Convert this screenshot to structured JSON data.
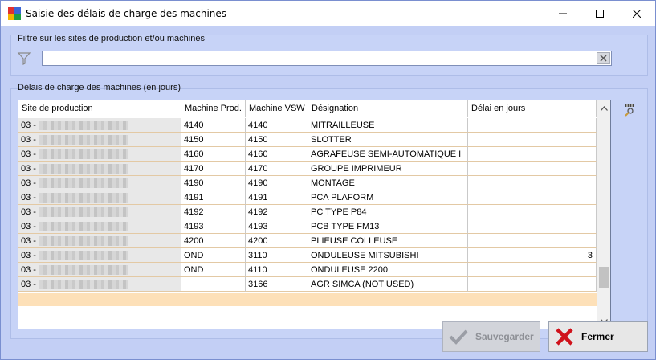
{
  "window": {
    "title": "Saisie des délais de charge des machines",
    "minimize_glyph": "—",
    "maximize_glyph": "☐",
    "close_glyph": "✕"
  },
  "filter": {
    "label": "Filtre sur les sites de production et/ou machines",
    "value": "",
    "icon": "funnel-icon",
    "clear_icon": "clear-x-icon"
  },
  "grid": {
    "label": "Délais de charge des machines (en jours)",
    "columns": [
      "Site de production",
      "Machine Prod.",
      "Machine VSW",
      "Désignation",
      "Délai en jours"
    ],
    "rows": [
      {
        "site": "03 -",
        "prod": "4140",
        "vsw": "4140",
        "designation": "MITRAILLEUSE",
        "delai": ""
      },
      {
        "site": "03 -",
        "prod": "4150",
        "vsw": "4150",
        "designation": "SLOTTER",
        "delai": ""
      },
      {
        "site": "03 -",
        "prod": "4160",
        "vsw": "4160",
        "designation": "AGRAFEUSE SEMI-AUTOMATIQUE I",
        "delai": ""
      },
      {
        "site": "03 -",
        "prod": "4170",
        "vsw": "4170",
        "designation": "GROUPE IMPRIMEUR",
        "delai": ""
      },
      {
        "site": "03 -",
        "prod": "4190",
        "vsw": "4190",
        "designation": "MONTAGE",
        "delai": ""
      },
      {
        "site": "03 -",
        "prod": "4191",
        "vsw": "4191",
        "designation": "PCA PLAFORM",
        "delai": ""
      },
      {
        "site": "03 -",
        "prod": "4192",
        "vsw": "4192",
        "designation": "PC TYPE P84",
        "delai": ""
      },
      {
        "site": "03 -",
        "prod": "4193",
        "vsw": "4193",
        "designation": "PCB TYPE FM13",
        "delai": ""
      },
      {
        "site": "03 -",
        "prod": "4200",
        "vsw": "4200",
        "designation": "PLIEUSE COLLEUSE",
        "delai": ""
      },
      {
        "site": "03 -",
        "prod": "OND",
        "vsw": "3110",
        "designation": "ONDULEUSE MITSUBISHI",
        "delai": "3"
      },
      {
        "site": "03 -",
        "prod": "OND",
        "vsw": "4110",
        "designation": "ONDULEUSE 2200",
        "delai": ""
      },
      {
        "site": "03 -",
        "prod": "",
        "vsw": "3166",
        "designation": "AGR SIMCA (NOT USED)",
        "delai": ""
      }
    ],
    "new_row_color": "#fde0b8",
    "column_chooser_icon": "column-chooser-icon"
  },
  "buttons": {
    "save": {
      "label": "Sauvegarder",
      "enabled": false,
      "icon": "checkmark-icon"
    },
    "close": {
      "label": "Fermer",
      "icon": "red-x-icon"
    }
  },
  "colors": {
    "background": "#c3cff5",
    "accent_red": "#d0121b"
  }
}
